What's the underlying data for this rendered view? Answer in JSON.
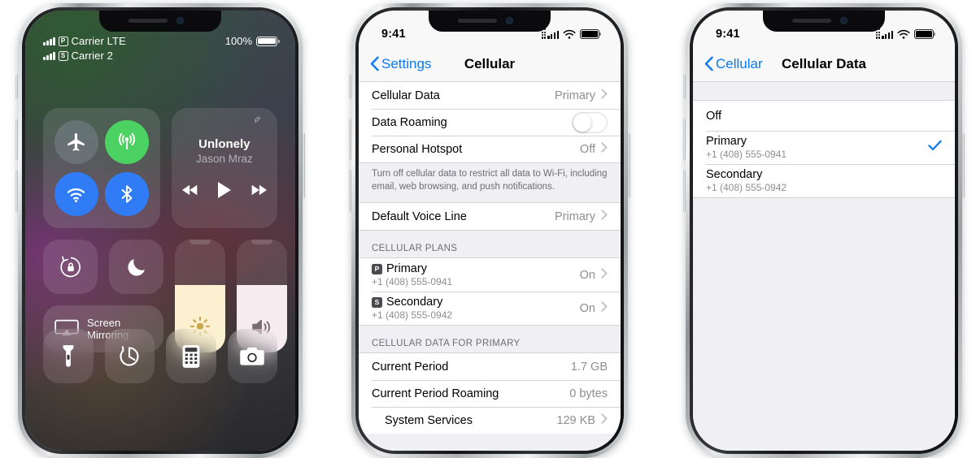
{
  "phone1": {
    "name": "control-center",
    "status": {
      "carriers": [
        {
          "badge": "P",
          "name": "Carrier LTE"
        },
        {
          "badge": "S",
          "name": "Carrier 2"
        }
      ],
      "battery_percent": "100%"
    },
    "connectivity": {
      "airplane": "airplane-mode",
      "cellular": "cellular-data",
      "wifi": "wifi",
      "bluetooth": "bluetooth"
    },
    "media": {
      "title": "Unlonely",
      "artist": "Jason Mraz",
      "airplay": "airplay-icon",
      "rewind": "rewind-button",
      "play": "play-button",
      "forward": "fast-forward-button"
    },
    "toggles": {
      "rotation_lock": "rotation-lock",
      "do_not_disturb": "do-not-disturb",
      "screen_mirroring_label_line1": "Screen",
      "screen_mirroring_label_line2": "Mirroring"
    },
    "sliders": {
      "brightness_percent": 60,
      "volume_percent": 60
    },
    "shortcuts": [
      {
        "name": "flashlight"
      },
      {
        "name": "timer"
      },
      {
        "name": "calculator"
      },
      {
        "name": "camera"
      }
    ]
  },
  "phone2": {
    "status": {
      "time": "9:41"
    },
    "nav": {
      "back": "Settings",
      "title": "Cellular"
    },
    "group1": [
      {
        "label": "Cellular Data",
        "value": "Primary",
        "chevron": true
      },
      {
        "label": "Data Roaming",
        "toggle": false
      },
      {
        "label": "Personal Hotspot",
        "value": "Off",
        "chevron": true
      }
    ],
    "footer1": "Turn off cellular data to restrict all data to Wi-Fi, including email, web browsing, and push notifications.",
    "group2": [
      {
        "label": "Default Voice Line",
        "value": "Primary",
        "chevron": true
      }
    ],
    "plans_header": "CELLULAR PLANS",
    "plans": [
      {
        "badge": "P",
        "label": "Primary",
        "sub": "+1 (408) 555-0941",
        "value": "On",
        "chevron": true
      },
      {
        "badge": "S",
        "label": "Secondary",
        "sub": "+1 (408) 555-0942",
        "value": "On",
        "chevron": true
      }
    ],
    "data_header": "CELLULAR DATA FOR PRIMARY",
    "data_rows": [
      {
        "label": "Current Period",
        "value": "1.7 GB",
        "chevron": false,
        "indent": false
      },
      {
        "label": "Current Period Roaming",
        "value": "0 bytes",
        "chevron": false,
        "indent": false
      },
      {
        "label": "System Services",
        "value": "129 KB",
        "chevron": true,
        "indent": true
      }
    ]
  },
  "phone3": {
    "status": {
      "time": "9:41"
    },
    "nav": {
      "back": "Cellular",
      "title": "Cellular Data"
    },
    "options": [
      {
        "label": "Off",
        "sub": "",
        "selected": false
      },
      {
        "label": "Primary",
        "sub": "+1 (408) 555-0941",
        "selected": true
      },
      {
        "label": "Secondary",
        "sub": "+1 (408) 555-0942",
        "selected": false
      }
    ]
  },
  "colors": {
    "ios_blue": "#0a78f0",
    "ios_green": "#4cd263",
    "ios_gray_bg": "#efeff4",
    "secondary_text": "#8e8e93"
  }
}
